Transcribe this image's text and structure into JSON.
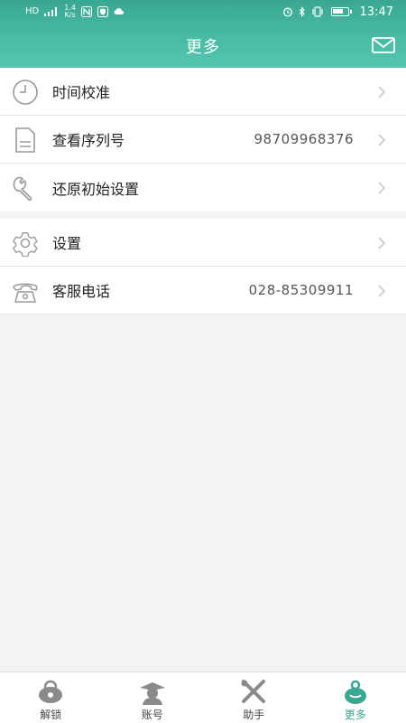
{
  "status_bar": {
    "net_speed_value": "1.4",
    "net_speed_unit": "K/s",
    "time": "13:47"
  },
  "header": {
    "title": "更多"
  },
  "menu_group1": [
    {
      "label": "时间校准",
      "value": "",
      "icon": "clock-icon"
    },
    {
      "label": "查看序列号",
      "value": "98709968376",
      "icon": "document-icon"
    },
    {
      "label": "还原初始设置",
      "value": "",
      "icon": "wrench-icon"
    }
  ],
  "menu_group2": [
    {
      "label": "设置",
      "value": "",
      "icon": "gear-icon"
    },
    {
      "label": "客服电话",
      "value": "028-85309911",
      "icon": "telephone-icon"
    }
  ],
  "tabs": [
    {
      "label": "解锁",
      "icon": "unlock-icon",
      "active": false
    },
    {
      "label": "账号",
      "icon": "account-icon",
      "active": false
    },
    {
      "label": "助手",
      "icon": "tools-icon",
      "active": false
    },
    {
      "label": "更多",
      "icon": "more-icon",
      "active": true
    }
  ],
  "colors": {
    "accent": "#3aa791",
    "icon_gray": "#9a9a9a"
  }
}
